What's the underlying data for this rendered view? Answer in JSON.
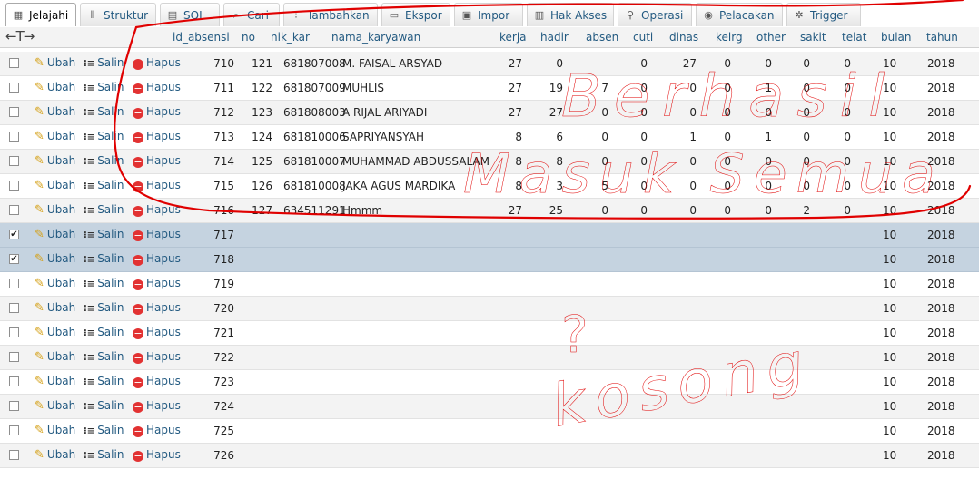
{
  "tabs": [
    {
      "label": "Jelajahi",
      "icon": "browse-icon",
      "glyph": "▦",
      "active": true
    },
    {
      "label": "Struktur",
      "icon": "structure-icon",
      "glyph": "⫴"
    },
    {
      "label": "SQL",
      "icon": "sql-icon",
      "glyph": "▤"
    },
    {
      "label": "Cari",
      "icon": "search-icon",
      "glyph": "⌕"
    },
    {
      "label": "Tambahkan",
      "icon": "insert-icon",
      "glyph": "⁝"
    },
    {
      "label": "Ekspor",
      "icon": "export-icon",
      "glyph": "▭"
    },
    {
      "label": "Impor",
      "icon": "import-icon",
      "glyph": "▣"
    },
    {
      "label": "Hak Akses",
      "icon": "privileges-icon",
      "glyph": "▥"
    },
    {
      "label": "Operasi",
      "icon": "wrench-icon",
      "glyph": "⚲"
    },
    {
      "label": "Pelacakan",
      "icon": "eye-icon",
      "glyph": "◉"
    },
    {
      "label": "Trigger",
      "icon": "trigger-icon",
      "glyph": "✲"
    }
  ],
  "table": {
    "arrows": "←T→",
    "columns": [
      "id_absensi",
      "no",
      "nik_kar",
      "nama_karyawan",
      "kerja",
      "hadir",
      "absen",
      "cuti",
      "dinas",
      "kelrg",
      "other",
      "sakit",
      "telat",
      "bulan",
      "tahun"
    ],
    "actions": {
      "edit": "Ubah",
      "copy": "Salin",
      "delete": "Hapus"
    },
    "rows": [
      {
        "checked": false,
        "cells": [
          "710",
          "121",
          "681807008",
          "M. FAISAL ARSYAD",
          "27",
          "0",
          "",
          "0",
          "27",
          "0",
          "0",
          "0",
          "0",
          "10",
          "2018"
        ]
      },
      {
        "checked": false,
        "cells": [
          "711",
          "122",
          "681807009",
          "MUHLIS",
          "27",
          "19",
          "7",
          "0",
          "0",
          "0",
          "1",
          "0",
          "0",
          "10",
          "2018"
        ]
      },
      {
        "checked": false,
        "cells": [
          "712",
          "123",
          "681808003",
          "A RIJAL ARIYADI",
          "27",
          "27",
          "0",
          "0",
          "0",
          "0",
          "0",
          "0",
          "0",
          "10",
          "2018"
        ]
      },
      {
        "checked": false,
        "cells": [
          "713",
          "124",
          "681810006",
          "SAPRIYANSYAH",
          "8",
          "6",
          "0",
          "0",
          "1",
          "0",
          "1",
          "0",
          "0",
          "10",
          "2018"
        ]
      },
      {
        "checked": false,
        "cells": [
          "714",
          "125",
          "681810007",
          "MUHAMMAD ABDUSSALAM",
          "8",
          "8",
          "0",
          "0",
          "0",
          "0",
          "0",
          "0",
          "0",
          "10",
          "2018"
        ]
      },
      {
        "checked": false,
        "cells": [
          "715",
          "126",
          "681810008",
          "JAKA AGUS MARDIKA",
          "8",
          "3",
          "5",
          "0",
          "0",
          "0",
          "0",
          "0",
          "0",
          "10",
          "2018"
        ]
      },
      {
        "checked": false,
        "cells": [
          "716",
          "127",
          "634511291",
          "Hmmm",
          "27",
          "25",
          "0",
          "0",
          "0",
          "0",
          "0",
          "2",
          "0",
          "10",
          "2018"
        ]
      },
      {
        "checked": true,
        "cells": [
          "717",
          "",
          "",
          "",
          "",
          "",
          "",
          "",
          "",
          "",
          "",
          "",
          "",
          "10",
          "2018"
        ]
      },
      {
        "checked": true,
        "cells": [
          "718",
          "",
          "",
          "",
          "",
          "",
          "",
          "",
          "",
          "",
          "",
          "",
          "",
          "10",
          "2018"
        ]
      },
      {
        "checked": false,
        "cells": [
          "719",
          "",
          "",
          "",
          "",
          "",
          "",
          "",
          "",
          "",
          "",
          "",
          "",
          "10",
          "2018"
        ]
      },
      {
        "checked": false,
        "cells": [
          "720",
          "",
          "",
          "",
          "",
          "",
          "",
          "",
          "",
          "",
          "",
          "",
          "",
          "10",
          "2018"
        ]
      },
      {
        "checked": false,
        "cells": [
          "721",
          "",
          "",
          "",
          "",
          "",
          "",
          "",
          "",
          "",
          "",
          "",
          "",
          "10",
          "2018"
        ]
      },
      {
        "checked": false,
        "cells": [
          "722",
          "",
          "",
          "",
          "",
          "",
          "",
          "",
          "",
          "",
          "",
          "",
          "",
          "10",
          "2018"
        ]
      },
      {
        "checked": false,
        "cells": [
          "723",
          "",
          "",
          "",
          "",
          "",
          "",
          "",
          "",
          "",
          "",
          "",
          "",
          "10",
          "2018"
        ]
      },
      {
        "checked": false,
        "cells": [
          "724",
          "",
          "",
          "",
          "",
          "",
          "",
          "",
          "",
          "",
          "",
          "",
          "",
          "10",
          "2018"
        ]
      },
      {
        "checked": false,
        "cells": [
          "725",
          "",
          "",
          "",
          "",
          "",
          "",
          "",
          "",
          "",
          "",
          "",
          "",
          "10",
          "2018"
        ]
      },
      {
        "checked": false,
        "cells": [
          "726",
          "",
          "",
          "",
          "",
          "",
          "",
          "",
          "",
          "",
          "",
          "",
          "",
          "10",
          "2018"
        ]
      }
    ]
  },
  "annotations": {
    "text1": "Berhasil",
    "text2": "Masuk Semua",
    "text3": "?",
    "text4": "kosong",
    "ink_color": "#e00000"
  }
}
